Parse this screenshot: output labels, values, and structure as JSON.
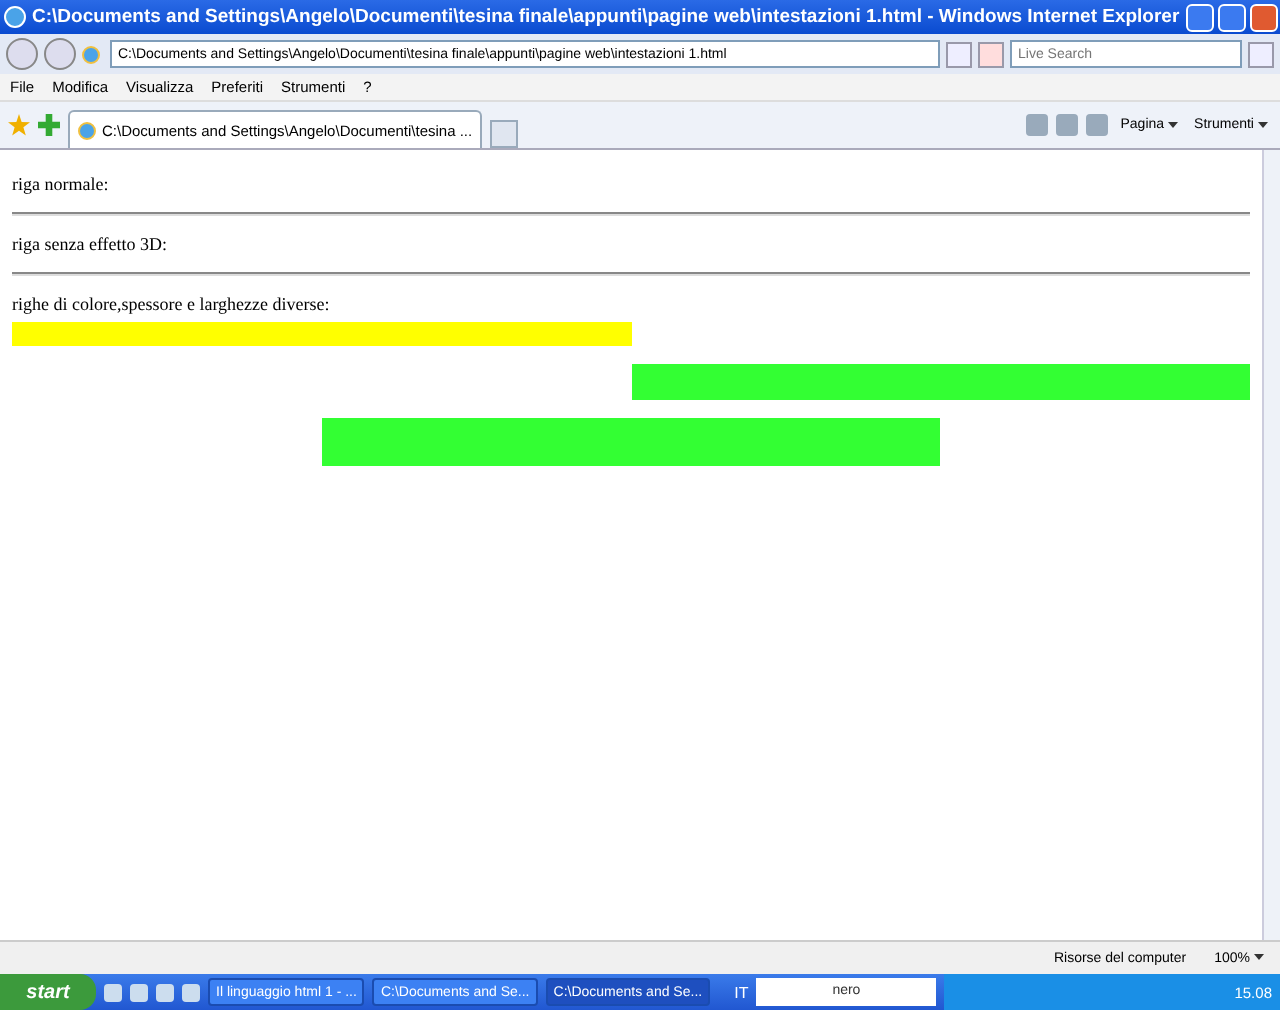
{
  "window": {
    "title": "C:\\Documents and Settings\\Angelo\\Documenti\\tesina finale\\appunti\\pagine web\\intestazioni 1.html - Windows Internet Explorer"
  },
  "address_bar": {
    "value": "C:\\Documents and Settings\\Angelo\\Documenti\\tesina finale\\appunti\\pagine web\\intestazioni 1.html"
  },
  "search": {
    "placeholder": "Live Search"
  },
  "menu": [
    "File",
    "Modifica",
    "Visualizza",
    "Preferiti",
    "Strumenti",
    "?"
  ],
  "tabs": [
    {
      "label": "C:\\Documents and Settings\\Angelo\\Documenti\\tesina ...",
      "selected": true
    }
  ],
  "toolbar": {
    "page": "Pagina",
    "tools": "Strumenti"
  },
  "content": [
    {
      "kind": "text",
      "text": "riga normale:"
    },
    {
      "kind": "rule"
    },
    {
      "kind": "text",
      "text": "riga senza effetto 3D:"
    },
    {
      "kind": "rule"
    },
    {
      "kind": "text",
      "text": "righe di colore,spessore e larghezze diverse:"
    },
    {
      "kind": "leftbar",
      "color": "#ffff00"
    },
    {
      "kind": "rightbar",
      "color": "#33ff33"
    },
    {
      "kind": "centerbar",
      "color": "#33ff33"
    }
  ],
  "status_bar": {
    "zone": "Risorse del computer",
    "zoom": "100%"
  },
  "taskbar": {
    "start": "start",
    "tasks": [
      {
        "label": "Il linguaggio html 1 - ...",
        "selected": false
      },
      {
        "label": "C:\\Documents and Se...",
        "selected": false
      },
      {
        "label": "C:\\Documents and Se...",
        "selected": true
      }
    ],
    "language": "IT",
    "nero": "nero",
    "clock": "15.08"
  }
}
